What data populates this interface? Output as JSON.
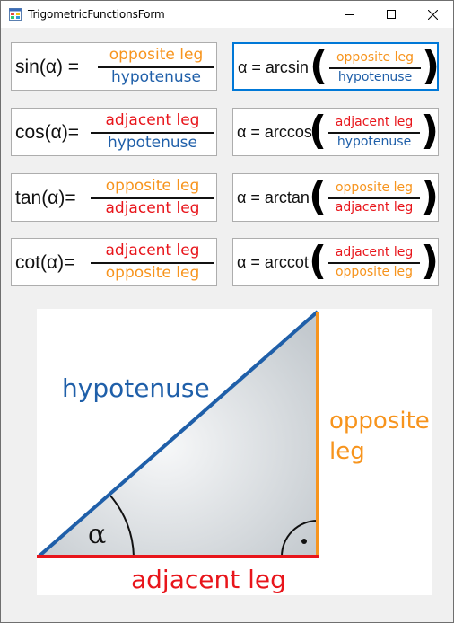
{
  "window": {
    "title": "TrigometricFunctionsForm",
    "colors": {
      "orange": "#f7941d",
      "blue": "#1f5fa9",
      "red": "#e8151b",
      "focus": "#0078d7"
    }
  },
  "formulas": [
    {
      "fn": "sin(α) =",
      "num": "opposite leg",
      "den": "hypotenuse"
    },
    {
      "fn": "cos(α)=",
      "num": "adjacent leg",
      "den": "hypotenuse"
    },
    {
      "fn": "tan(α)=",
      "num": "opposite leg",
      "den": "adjacent leg"
    },
    {
      "fn": "cot(α)=",
      "num": "adjacent leg",
      "den": "opposite leg"
    }
  ],
  "inverse": [
    {
      "fn": "α = arcsin",
      "num": "opposite leg",
      "den": "hypotenuse"
    },
    {
      "fn": "α = arccos",
      "num": "adjacent leg",
      "den": "hypotenuse"
    },
    {
      "fn": "α = arctan",
      "num": "opposite leg",
      "den": "adjacent leg"
    },
    {
      "fn": "α = arccot",
      "num": "adjacent leg",
      "den": "opposite leg"
    }
  ],
  "diagram": {
    "hypotenuse": "hypotenuse",
    "opposite_line1": "opposite",
    "opposite_line2": "leg",
    "adjacent": "adjacent leg",
    "angle": "α"
  }
}
